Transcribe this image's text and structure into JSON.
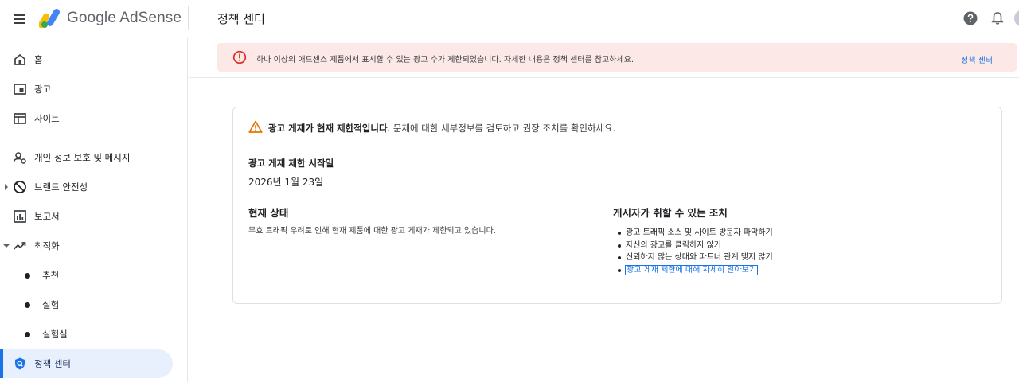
{
  "header": {
    "app_name": "Google AdSense",
    "page_title": "정책 센터",
    "menu_icon": "menu-icon",
    "help_icon": "help-icon",
    "notifications_icon": "bell-icon",
    "brand_colors": [
      "#fbbc04",
      "#4285f4",
      "#34a853"
    ]
  },
  "sidebar": {
    "items": [
      {
        "label": "홈",
        "icon": "home-icon"
      },
      {
        "label": "광고",
        "icon": "ads-icon"
      },
      {
        "label": "사이트",
        "icon": "sites-icon"
      },
      {
        "label": "개인 정보 보호 및 메시지",
        "icon": "privacy-icon"
      },
      {
        "label": "브랜드 안전성",
        "icon": "block-icon"
      },
      {
        "label": "보고서",
        "icon": "reports-icon"
      },
      {
        "label": "최적화",
        "icon": "trending-icon"
      },
      {
        "label": "추천"
      },
      {
        "label": "실험"
      },
      {
        "label": "실험실"
      },
      {
        "label": "정책 센터",
        "icon": "shield-icon",
        "active": true
      }
    ],
    "active_color": "#1a73e8"
  },
  "alert": {
    "text": "하나 이상의 애드센스 제품에서 표시할 수 있는 광고 수가 제한되었습니다. 자세한 내용은 정책 센터를 참고하세요.",
    "link": "정책 센터",
    "icon": "error-icon",
    "color": "#d93025"
  },
  "card": {
    "headline_bold": "광고 게재가 현재 제한적입니다",
    "headline_rest": ". 문제에 대한 세부정보를 검토하고 권장 조치를 확인하세요.",
    "warn_icon": "warning-icon",
    "start_label": "광고 게재 제한 시작일",
    "start_date": "2026년 1월 23일",
    "status_title": "현재 상태",
    "status_text": "무효 트래픽 우려로 인해 현재 제품에 대한 광고 게재가 제한되고 있습니다.",
    "actions_title": "게시자가 취할 수 있는 조치",
    "actions": [
      "광고 트래픽 소스 및 사이트 방문자 파악하기",
      "자신의 광고를 클릭하지 않기",
      "신뢰하지 않는 상대와 파트너 관계 맺지 않기"
    ],
    "learn_more_link": "광고 게재 제한에 대해 자세히 알아보기"
  }
}
